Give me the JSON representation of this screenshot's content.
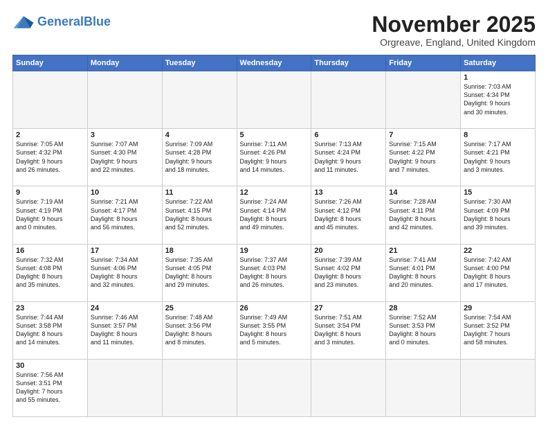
{
  "header": {
    "logo_general": "General",
    "logo_blue": "Blue",
    "month_title": "November 2025",
    "location": "Orgreave, England, United Kingdom"
  },
  "days_of_week": [
    "Sunday",
    "Monday",
    "Tuesday",
    "Wednesday",
    "Thursday",
    "Friday",
    "Saturday"
  ],
  "weeks": [
    [
      {
        "day": "",
        "info": ""
      },
      {
        "day": "",
        "info": ""
      },
      {
        "day": "",
        "info": ""
      },
      {
        "day": "",
        "info": ""
      },
      {
        "day": "",
        "info": ""
      },
      {
        "day": "",
        "info": ""
      },
      {
        "day": "1",
        "info": "Sunrise: 7:03 AM\nSunset: 4:34 PM\nDaylight: 9 hours\nand 30 minutes."
      }
    ],
    [
      {
        "day": "2",
        "info": "Sunrise: 7:05 AM\nSunset: 4:32 PM\nDaylight: 9 hours\nand 26 minutes."
      },
      {
        "day": "3",
        "info": "Sunrise: 7:07 AM\nSunset: 4:30 PM\nDaylight: 9 hours\nand 22 minutes."
      },
      {
        "day": "4",
        "info": "Sunrise: 7:09 AM\nSunset: 4:28 PM\nDaylight: 9 hours\nand 18 minutes."
      },
      {
        "day": "5",
        "info": "Sunrise: 7:11 AM\nSunset: 4:26 PM\nDaylight: 9 hours\nand 14 minutes."
      },
      {
        "day": "6",
        "info": "Sunrise: 7:13 AM\nSunset: 4:24 PM\nDaylight: 9 hours\nand 11 minutes."
      },
      {
        "day": "7",
        "info": "Sunrise: 7:15 AM\nSunset: 4:22 PM\nDaylight: 9 hours\nand 7 minutes."
      },
      {
        "day": "8",
        "info": "Sunrise: 7:17 AM\nSunset: 4:21 PM\nDaylight: 9 hours\nand 3 minutes."
      }
    ],
    [
      {
        "day": "9",
        "info": "Sunrise: 7:19 AM\nSunset: 4:19 PM\nDaylight: 9 hours\nand 0 minutes."
      },
      {
        "day": "10",
        "info": "Sunrise: 7:21 AM\nSunset: 4:17 PM\nDaylight: 8 hours\nand 56 minutes."
      },
      {
        "day": "11",
        "info": "Sunrise: 7:22 AM\nSunset: 4:15 PM\nDaylight: 8 hours\nand 52 minutes."
      },
      {
        "day": "12",
        "info": "Sunrise: 7:24 AM\nSunset: 4:14 PM\nDaylight: 8 hours\nand 49 minutes."
      },
      {
        "day": "13",
        "info": "Sunrise: 7:26 AM\nSunset: 4:12 PM\nDaylight: 8 hours\nand 45 minutes."
      },
      {
        "day": "14",
        "info": "Sunrise: 7:28 AM\nSunset: 4:11 PM\nDaylight: 8 hours\nand 42 minutes."
      },
      {
        "day": "15",
        "info": "Sunrise: 7:30 AM\nSunset: 4:09 PM\nDaylight: 8 hours\nand 39 minutes."
      }
    ],
    [
      {
        "day": "16",
        "info": "Sunrise: 7:32 AM\nSunset: 4:08 PM\nDaylight: 8 hours\nand 35 minutes."
      },
      {
        "day": "17",
        "info": "Sunrise: 7:34 AM\nSunset: 4:06 PM\nDaylight: 8 hours\nand 32 minutes."
      },
      {
        "day": "18",
        "info": "Sunrise: 7:35 AM\nSunset: 4:05 PM\nDaylight: 8 hours\nand 29 minutes."
      },
      {
        "day": "19",
        "info": "Sunrise: 7:37 AM\nSunset: 4:03 PM\nDaylight: 8 hours\nand 26 minutes."
      },
      {
        "day": "20",
        "info": "Sunrise: 7:39 AM\nSunset: 4:02 PM\nDaylight: 8 hours\nand 23 minutes."
      },
      {
        "day": "21",
        "info": "Sunrise: 7:41 AM\nSunset: 4:01 PM\nDaylight: 8 hours\nand 20 minutes."
      },
      {
        "day": "22",
        "info": "Sunrise: 7:42 AM\nSunset: 4:00 PM\nDaylight: 8 hours\nand 17 minutes."
      }
    ],
    [
      {
        "day": "23",
        "info": "Sunrise: 7:44 AM\nSunset: 3:58 PM\nDaylight: 8 hours\nand 14 minutes."
      },
      {
        "day": "24",
        "info": "Sunrise: 7:46 AM\nSunset: 3:57 PM\nDaylight: 8 hours\nand 11 minutes."
      },
      {
        "day": "25",
        "info": "Sunrise: 7:48 AM\nSunset: 3:56 PM\nDaylight: 8 hours\nand 8 minutes."
      },
      {
        "day": "26",
        "info": "Sunrise: 7:49 AM\nSunset: 3:55 PM\nDaylight: 8 hours\nand 5 minutes."
      },
      {
        "day": "27",
        "info": "Sunrise: 7:51 AM\nSunset: 3:54 PM\nDaylight: 8 hours\nand 3 minutes."
      },
      {
        "day": "28",
        "info": "Sunrise: 7:52 AM\nSunset: 3:53 PM\nDaylight: 8 hours\nand 0 minutes."
      },
      {
        "day": "29",
        "info": "Sunrise: 7:54 AM\nSunset: 3:52 PM\nDaylight: 7 hours\nand 58 minutes."
      }
    ],
    [
      {
        "day": "30",
        "info": "Sunrise: 7:56 AM\nSunset: 3:51 PM\nDaylight: 7 hours\nand 55 minutes."
      },
      {
        "day": "",
        "info": ""
      },
      {
        "day": "",
        "info": ""
      },
      {
        "day": "",
        "info": ""
      },
      {
        "day": "",
        "info": ""
      },
      {
        "day": "",
        "info": ""
      },
      {
        "day": "",
        "info": ""
      }
    ]
  ]
}
